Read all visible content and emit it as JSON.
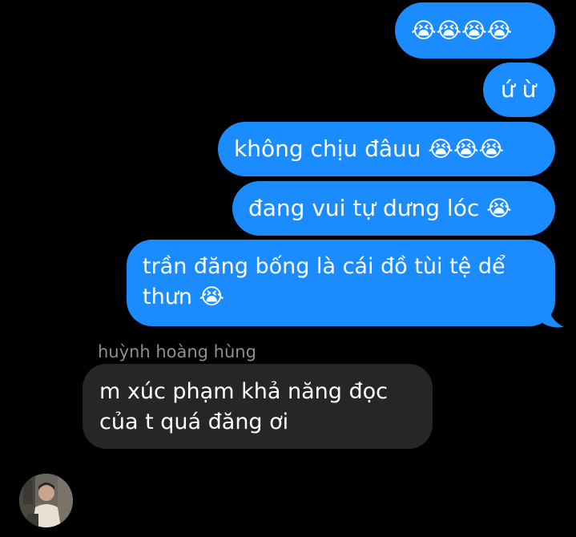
{
  "outgoing": [
    {
      "text": "",
      "emoji": "😭😭😭😭"
    },
    {
      "text": "ứ ừ",
      "emoji": ""
    },
    {
      "text": "không chịu đâuu ",
      "emoji": "😭😭😭"
    },
    {
      "text": "đang vui tự dưng lóc ",
      "emoji": "😭"
    },
    {
      "line1": "trần đăng bống là cái đồ tùi tệ dể",
      "line2": "thưn ",
      "emoji": "😭"
    }
  ],
  "incoming": {
    "sender": "huỳnh hoàng hùng",
    "line1": "m xúc phạm khả năng đọc",
    "line2": "của t quá đăng ơi",
    "big_emoji": [
      "😭",
      "😭",
      "😭"
    ]
  },
  "colors": {
    "outgoing_bubble": "#1a8cff",
    "incoming_bubble": "#262628",
    "background": "#000000"
  }
}
